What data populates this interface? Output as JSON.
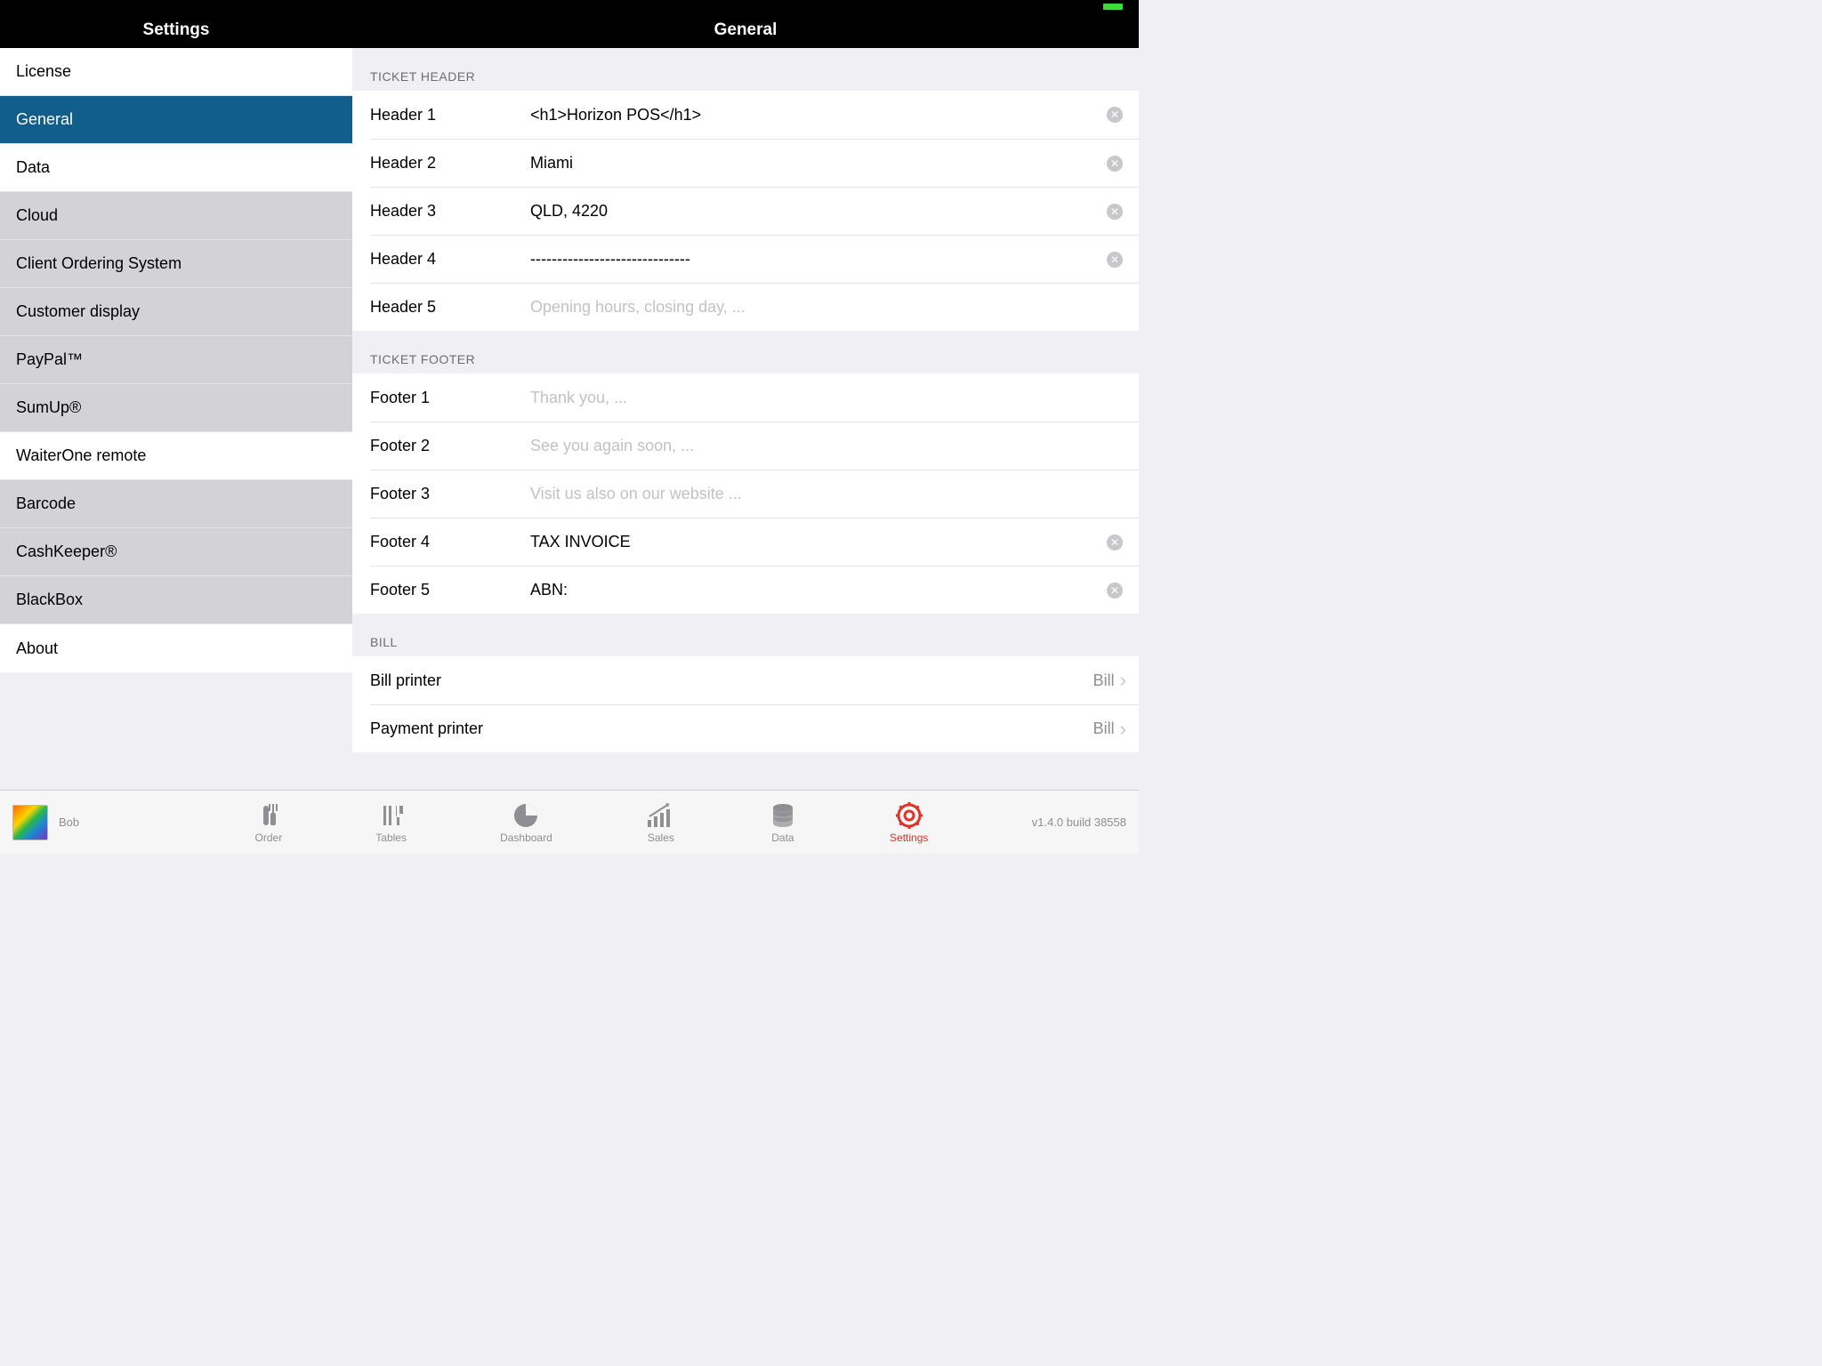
{
  "status": {
    "battery_color": "#3ddc3d"
  },
  "header": {
    "left": "Settings",
    "right": "General"
  },
  "sidebar": [
    {
      "label": "License",
      "state": "normal"
    },
    {
      "label": "General",
      "state": "selected"
    },
    {
      "label": "Data",
      "state": "normal"
    },
    {
      "label": "Cloud",
      "state": "disabled"
    },
    {
      "label": "Client Ordering System",
      "state": "disabled"
    },
    {
      "label": "Customer display",
      "state": "disabled"
    },
    {
      "label": "PayPal™",
      "state": "disabled"
    },
    {
      "label": "SumUp®",
      "state": "disabled"
    },
    {
      "label": "WaiterOne remote",
      "state": "normal"
    },
    {
      "label": "Barcode",
      "state": "disabled"
    },
    {
      "label": "CashKeeper®",
      "state": "disabled"
    },
    {
      "label": "BlackBox",
      "state": "disabled"
    },
    {
      "label": "About",
      "state": "normal"
    }
  ],
  "sections": {
    "ticket_header": {
      "title": "TICKET HEADER",
      "rows": [
        {
          "label": "Header 1",
          "value": "<h1>Horizon POS</h1>",
          "placeholder": ""
        },
        {
          "label": "Header 2",
          "value": "Miami",
          "placeholder": ""
        },
        {
          "label": "Header 3",
          "value": "QLD, 4220",
          "placeholder": ""
        },
        {
          "label": "Header 4",
          "value": "------------------------------",
          "placeholder": ""
        },
        {
          "label": "Header 5",
          "value": "",
          "placeholder": "Opening hours, closing day, ..."
        }
      ]
    },
    "ticket_footer": {
      "title": "TICKET FOOTER",
      "rows": [
        {
          "label": "Footer 1",
          "value": "",
          "placeholder": "Thank you, ..."
        },
        {
          "label": "Footer 2",
          "value": "",
          "placeholder": "See you again soon, ..."
        },
        {
          "label": "Footer 3",
          "value": "",
          "placeholder": "Visit us also on our website ..."
        },
        {
          "label": "Footer 4",
          "value": "TAX INVOICE",
          "placeholder": ""
        },
        {
          "label": "Footer 5",
          "value": "ABN:",
          "placeholder": ""
        }
      ]
    },
    "bill": {
      "title": "BILL",
      "rows": [
        {
          "label": "Bill printer",
          "value": "Bill"
        },
        {
          "label": "Payment printer",
          "value": "Bill"
        }
      ]
    }
  },
  "bottom": {
    "user": "Bob",
    "tabs": [
      {
        "label": "Order",
        "icon": "order"
      },
      {
        "label": "Tables",
        "icon": "tables"
      },
      {
        "label": "Dashboard",
        "icon": "dashboard"
      },
      {
        "label": "Sales",
        "icon": "sales"
      },
      {
        "label": "Data",
        "icon": "data"
      },
      {
        "label": "Settings",
        "icon": "settings",
        "active": true
      }
    ],
    "version": "v1.4.0 build 38558"
  }
}
